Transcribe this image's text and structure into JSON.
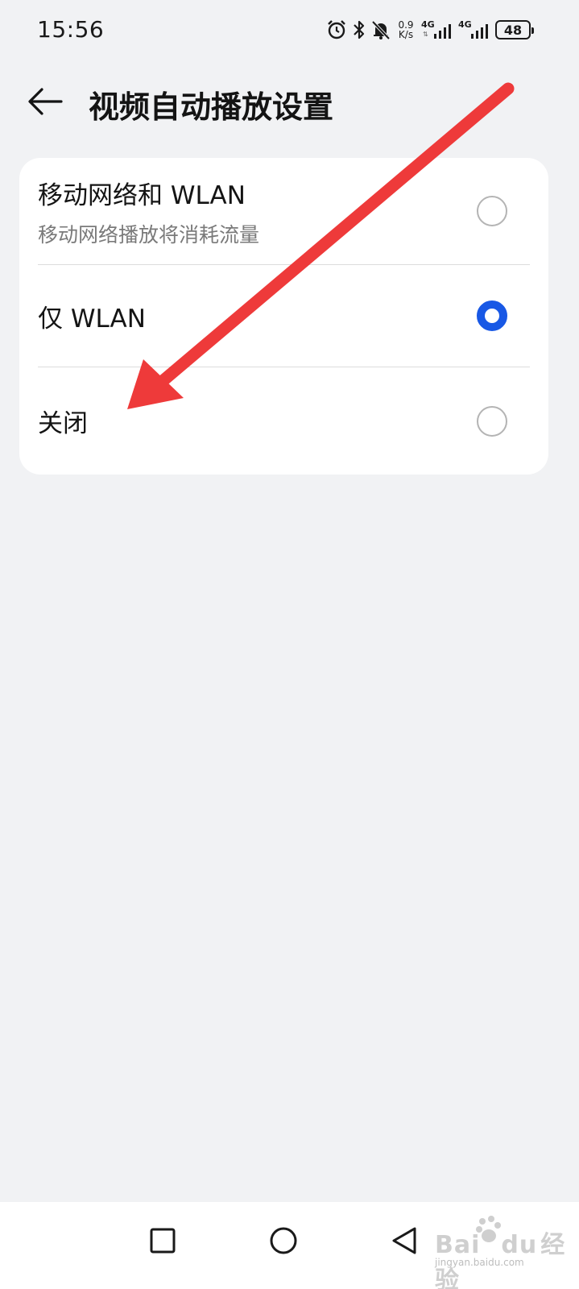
{
  "status_bar": {
    "time": "15:56",
    "speed_value": "0.9",
    "speed_unit": "K/s",
    "network_1": "4G",
    "network_2": "4G",
    "battery": "48",
    "icons": [
      "alarm-icon",
      "bluetooth-icon",
      "bell-off-icon",
      "signal-icon",
      "signal-icon",
      "battery-icon"
    ]
  },
  "header": {
    "title": "视频自动播放设置",
    "back_icon": "arrow-left-icon"
  },
  "options": [
    {
      "label": "移动网络和 WLAN",
      "sublabel": "移动网络播放将消耗流量",
      "selected": false
    },
    {
      "label": "仅 WLAN",
      "selected": true
    },
    {
      "label": "关闭",
      "selected": false
    }
  ],
  "colors": {
    "accent": "#1858e5",
    "background": "#f1f2f4",
    "card": "#ffffff",
    "annotation_arrow": "#ee3a3a"
  },
  "nav_bar": {
    "icons": [
      "square-icon",
      "circle-icon",
      "triangle-back-icon"
    ]
  },
  "watermark": {
    "text": "Bai",
    "text_2": "du",
    "text_3": "经验",
    "sub": "jingyan.baidu.com"
  }
}
